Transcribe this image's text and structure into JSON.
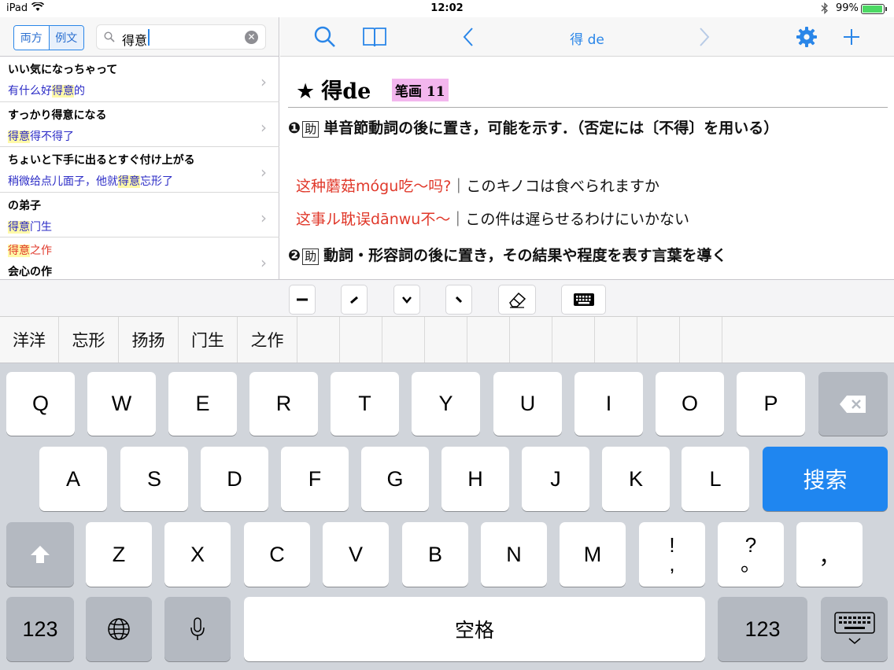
{
  "status": {
    "device": "iPad",
    "time": "12:02",
    "battery": "99%",
    "battery_level": 0.99
  },
  "left": {
    "seg_both": "両方",
    "seg_examples": "例文",
    "search_value": "得意",
    "results": [
      {
        "ja": "いい気になっちゃって",
        "zh_pre": "有什么好",
        "zh_hl": "得意",
        "zh_post": "的"
      },
      {
        "ja": "すっかり得意になる",
        "zh_pre": "",
        "zh_hl": "得意",
        "zh_post": "得不得了"
      },
      {
        "ja": "ちょいと下手に出るとすぐ付け上がる",
        "zh_pre": "稍微给点儿面子，他就",
        "zh_hl": "得意",
        "zh_post": "忘形了"
      },
      {
        "ja": "の弟子",
        "zh_pre": "",
        "zh_hl": "得意",
        "zh_post": "门生"
      },
      {
        "ja_pre": "",
        "ja_hl": "得意",
        "ja_post": "之作",
        "zh": "会心の作"
      }
    ]
  },
  "right": {
    "nav_title": "得 de",
    "headword": "得de",
    "stroke_label": "笔画 11",
    "def1_num": "❶",
    "def1_pos": "助",
    "def1_text": "単音節動詞の後に置き，可能を示す．（否定には〔不得〕を用いる）",
    "ex1_zh": "这种蘑菇mógu吃～吗?",
    "ex1_ja": "｜このキノコは食べられますか",
    "ex2_zh": "这事ル耽误dānwu不～",
    "ex2_ja": "｜この件は遅らせるわけにいかない",
    "def2_num": "❷",
    "def2_pos": "助",
    "def2_text": "動詞・形容詞の後に置き，その結果や程度を表す言葉を導く"
  },
  "candidates": [
    "洋洋",
    "忘形",
    "扬扬",
    "门生",
    "之作"
  ],
  "keyboard": {
    "row1": [
      "Q",
      "W",
      "E",
      "R",
      "T",
      "Y",
      "U",
      "I",
      "O",
      "P"
    ],
    "row2": [
      "A",
      "S",
      "D",
      "F",
      "G",
      "H",
      "J",
      "K",
      "L"
    ],
    "row3": [
      "Z",
      "X",
      "C",
      "V",
      "B",
      "N",
      "M"
    ],
    "excl_top": "!",
    "excl_bottom": ",",
    "q_top": "?",
    "q_bottom": "。",
    "comma": "，",
    "search_key": "搜索",
    "num_key": "123",
    "space_key": "空格"
  }
}
